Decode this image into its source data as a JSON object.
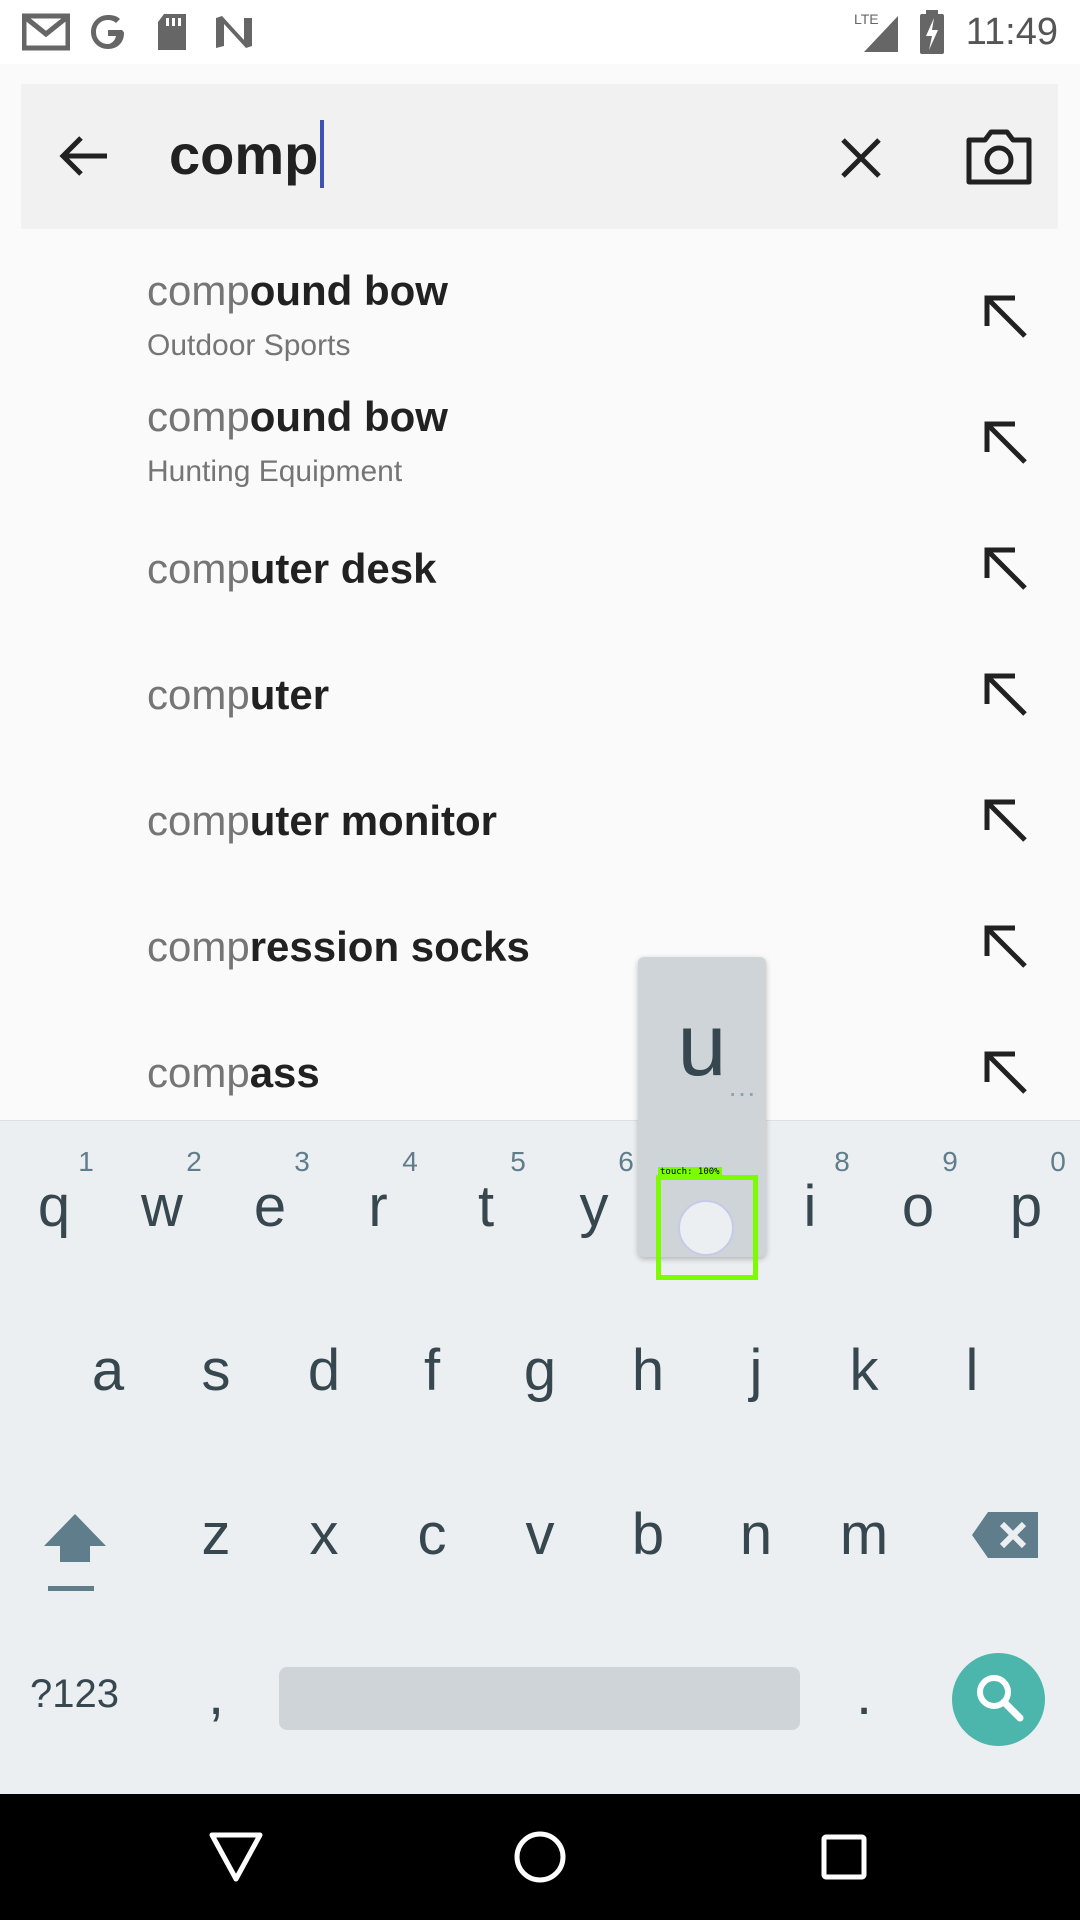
{
  "status_bar": {
    "time": "11:49",
    "network": "LTE",
    "icons": [
      "gmail-icon",
      "google-icon",
      "sd-card-icon",
      "n-icon",
      "signal-icon",
      "battery-charging-icon"
    ]
  },
  "search": {
    "query": "comp",
    "icons": [
      "back-arrow-icon",
      "clear-icon",
      "camera-icon"
    ]
  },
  "suggestions": [
    {
      "prefix": "comp",
      "rest": "ound bow",
      "category": "Outdoor Sports"
    },
    {
      "prefix": "comp",
      "rest": "ound bow",
      "category": "Hunting Equipment"
    },
    {
      "prefix": "comp",
      "rest": "uter desk"
    },
    {
      "prefix": "comp",
      "rest": "uter"
    },
    {
      "prefix": "comp",
      "rest": "uter monitor"
    },
    {
      "prefix": "comp",
      "rest": "ression socks"
    },
    {
      "prefix": "comp",
      "rest": "ass"
    }
  ],
  "keyboard": {
    "row1": [
      "q",
      "w",
      "e",
      "r",
      "t",
      "y",
      "u",
      "i",
      "o",
      "p"
    ],
    "hints": [
      "1",
      "2",
      "3",
      "4",
      "5",
      "6",
      "7",
      "8",
      "9",
      "0"
    ],
    "row2": [
      "a",
      "s",
      "d",
      "f",
      "g",
      "h",
      "j",
      "k",
      "l"
    ],
    "row3": [
      "z",
      "x",
      "c",
      "v",
      "b",
      "n",
      "m"
    ],
    "symbols_label": "?123",
    "comma": ",",
    "period": ".",
    "popup_letter": "u",
    "touch_label": "touch: 100%"
  },
  "colors": {
    "accent": "#3f51b5",
    "search_key": "#4db6ac",
    "touch_box": "#7cfc00"
  }
}
